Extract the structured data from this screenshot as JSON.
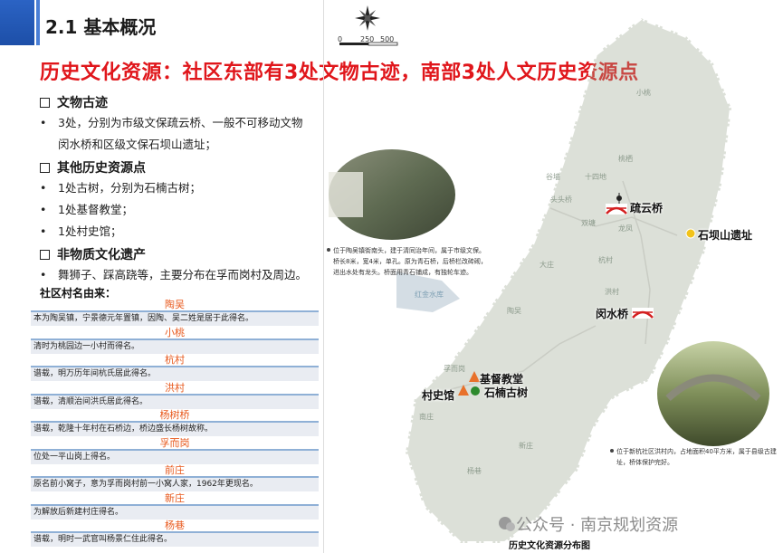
{
  "header": {
    "section_title": "2.1  基本概况",
    "main_title": "历史文化资源：社区东部有3处文物古迹，南部3处人文历史资源点"
  },
  "sections": [
    {
      "heading": "文物古迹",
      "bullets": [
        "3处，分别为市级文保疏云桥、一般不可移动文物",
        "闵水桥和区级文保石坝山遗址；"
      ]
    },
    {
      "heading": "其他历史资源点",
      "bullets": [
        "1处古树，分别为石楠古树；",
        "1处基督教堂；",
        "1处村史馆；"
      ]
    },
    {
      "heading": "非物质文化遗产",
      "bullets": [
        "舞狮子、踩高跷等，主要分布在孚而岗村及周边。"
      ]
    }
  ],
  "villages": {
    "title": "社区村名由来：",
    "rows": [
      {
        "name": "陶吴",
        "desc": "本为陶吴镇，宁景德元年置镇，因陶、吴二姓是居于此得名。"
      },
      {
        "name": "小桃",
        "desc": "清时为桃园边一小村而得名。"
      },
      {
        "name": "杭村",
        "desc": "谱载，明万历年间杭氏居此得名。"
      },
      {
        "name": "洪村",
        "desc": "谱载，清顺治间洪氏居此得名。"
      },
      {
        "name": "杨树桥",
        "desc": "谱载，乾隆十年村在石桥边，桥边盛长杨树故称。"
      },
      {
        "name": "孚而岗",
        "desc": "位处一平山岗上得名。"
      },
      {
        "name": "前庄",
        "desc": "原名前小窝子，意为孚而岗村前一小窝人家，1962年更现名。"
      },
      {
        "name": "新庄",
        "desc": "为解放后新建村庄得名。"
      },
      {
        "name": "杨巷",
        "desc": "谱载，明时一武官叫杨景仁住此得名。"
      }
    ]
  },
  "map": {
    "scale": {
      "zero": "0",
      "mid": "250",
      "max": "500"
    },
    "place_labels": [
      "小桃",
      "十四地",
      "谷墙",
      "头头桥",
      "双塘",
      "桃栖",
      "龙凤",
      "大庄",
      "杭村",
      "洪村",
      "陶吴",
      "孚而岗",
      "南庄",
      "新庄",
      "杨巷",
      "红金水库"
    ],
    "sites": {
      "shuyun": "疏云桥",
      "shiba": "石坝山遗址",
      "minshui": "闵水桥",
      "church": "基督教堂",
      "museum": "村史馆",
      "tree": "石楠古树"
    },
    "caption_top": [
      "位于陶吴镇街南头，建于清同治年间，属于市级文保。",
      "桥长8米，宽4米，单孔。原为青石桥，后桥栏改砖砌，",
      "进出水处有龙头。桥面用青石铺成，有独轮车迹。"
    ],
    "caption_bottom": [
      "位于新杭社区洪村内，占地面积40平方米，属于县级古建",
      "址，桥体保护完好。"
    ],
    "figure_caption": "历史文化资源分布图",
    "watermark": "公众号 · 南京规划资源"
  },
  "colors": {
    "accent": "#e0161b",
    "header_blue": "#2b63c4",
    "village_name": "#e8591d",
    "table_line": "#8fb0d6"
  }
}
